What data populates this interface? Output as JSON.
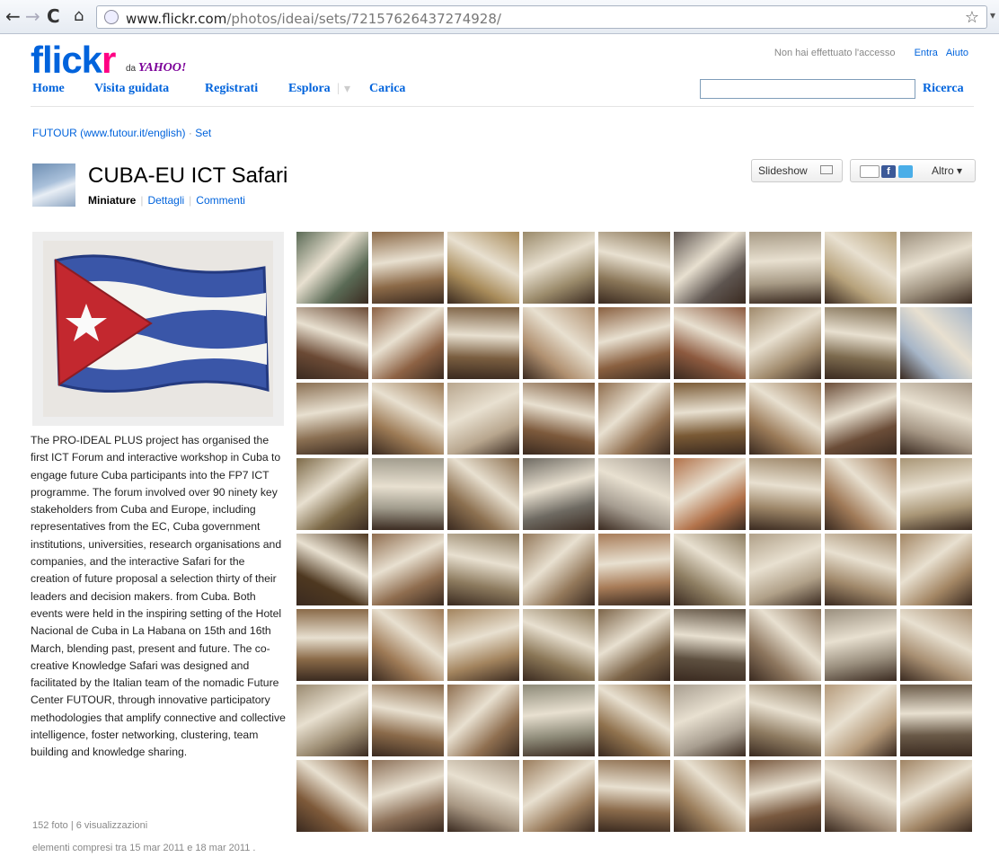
{
  "browser": {
    "url_host": "www.flickr.com",
    "url_path": "/photos/ideai/sets/72157626437274928/"
  },
  "header": {
    "logo_part1": "flick",
    "logo_part2": "r",
    "logo_sub": "da",
    "logo_yahoo": "YAHOO!",
    "nav": {
      "home": "Home",
      "tour": "Visita guidata",
      "signup": "Registrati",
      "explore": "Esplora",
      "upload": "Carica",
      "sep": "|",
      "dropdown": "▾"
    },
    "account": {
      "status": "Non hai effettuato l'accesso",
      "signin": "Entra",
      "help": "Aiuto"
    },
    "search_button": "Ricerca"
  },
  "breadcrumb": {
    "owner": "FUTOUR (www.futour.it/english)",
    "sep": "·",
    "set": "Set"
  },
  "set": {
    "title": "CUBA-EU ICT Safari",
    "tabs": {
      "thumbs": "Miniature",
      "details": "Dettagli",
      "comments": "Commenti",
      "sep": "|"
    },
    "slideshow": "Slideshow",
    "more": "Altro ▾",
    "description": "The PRO-IDEAL PLUS project has organised the first ICT Forum and interactive workshop in Cuba to engage future Cuba participants into the FP7 ICT programme. The forum involved over 90 ninety key stakeholders from Cuba and Europe, including representatives from the EC, Cuba government institutions, universities, research organisations and companies, and the interactive Safari for the creation of future proposal a selection thirty of their leaders and decision makers. from Cuba. Both events were held in the inspiring setting of the Hotel Nacional de Cuba in La Habana on 15th and 16th March, blending past, present and future. The co-creative Knowledge Safari was designed and facilitated by the Italian team of the nomadic Future Center FUTOUR, through innovative participatory methodologies that amplify connective and collective intelligence, foster networking, clustering, team building and knowledge sharing.",
    "stats": "152 foto | 6 visualizzazioni",
    "date_range": "elementi compresi tra 15 mar 2011 e 18 mar 2011 ."
  },
  "icons": {
    "back": "←",
    "forward": "→",
    "reload": "C",
    "home": "⌂",
    "star": "☆",
    "wrench": "▾",
    "fb": "f"
  },
  "photo_colors": [
    "#5a6a55",
    "#8c6a48",
    "#a88b5a",
    "#9a8a6a",
    "#8a7658",
    "#5e5550",
    "#a89b86",
    "#b6a17a",
    "#9c8f7c",
    "#6b4a35",
    "#8d6244",
    "#7a5e40",
    "#b09070",
    "#8a6040",
    "#8d5a3f",
    "#a08a6c",
    "#7c6a4e",
    "#a7b6c8",
    "#8a6f52",
    "#9c7a55",
    "#b8a68e",
    "#7d5a3c",
    "#8f6d4d",
    "#7a5a35",
    "#9a7a58",
    "#6b4d38",
    "#a59684",
    "#7d6a48",
    "#a09b8c",
    "#8c7050",
    "#6e6a62",
    "#a59c90",
    "#b2724a",
    "#9b8466",
    "#a07a58",
    "#a99676",
    "#4e3820",
    "#8f6d4f",
    "#8c7a5e",
    "#93785a",
    "#a87c58",
    "#8e7e62",
    "#b0a088",
    "#a0886a",
    "#a38664",
    "#8a6a48",
    "#9e7a56",
    "#a3845e",
    "#8a7656",
    "#7c6448",
    "#5e5040",
    "#8d765e",
    "#9a8f7e",
    "#a88f72",
    "#9a8a70",
    "#8a6a4a",
    "#8f6f50",
    "#8d8a78",
    "#90724e",
    "#a89e90",
    "#8d7a60",
    "#b59a7a",
    "#6a5a48",
    "#7e5a3a",
    "#8c7058",
    "#a79682",
    "#9a7c5c",
    "#8c6c4c",
    "#9b7e5c",
    "#7a5a40",
    "#a38e78",
    "#a08464"
  ]
}
